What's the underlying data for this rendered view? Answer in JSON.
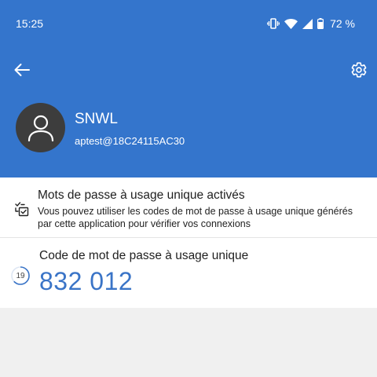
{
  "status_bar": {
    "time": "15:25",
    "battery": "72 %",
    "icons": [
      "vibrate-icon",
      "wifi-icon",
      "signal-icon",
      "battery-icon"
    ]
  },
  "toolbar": {
    "back_icon": "arrow-left-icon",
    "settings_icon": "gear-icon"
  },
  "account": {
    "avatar_icon": "person-icon",
    "name": "SNWL",
    "email": "aptest@18C24115AC30"
  },
  "otp_enabled": {
    "icon": "checklist-icon",
    "title": "Mots de passe à usage unique activés",
    "description": "Vous pouvez utiliser les codes de mot de passe à usage unique générés par cette application pour vérifier vos connexions"
  },
  "otp_code": {
    "label": "Code de mot de passe à usage unique",
    "timer_seconds": "19",
    "timer_fraction": 0.63,
    "value": "832 012"
  },
  "colors": {
    "header": "#3475cc",
    "avatar": "#3d3d3d",
    "code": "#3a74c7",
    "background": "#f0f0f0"
  }
}
